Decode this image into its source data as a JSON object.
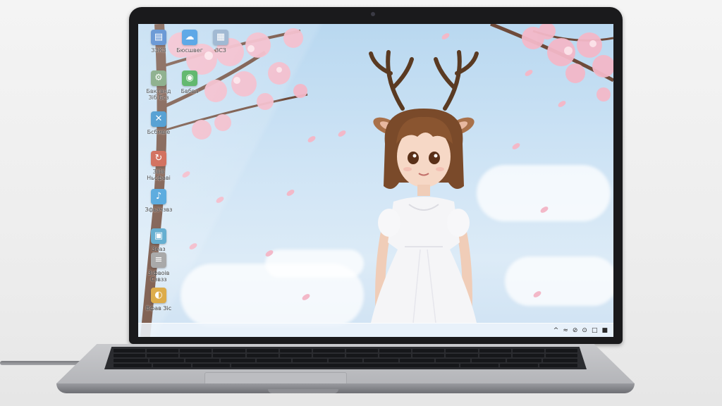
{
  "desktop": {
    "icons": [
      {
        "label": "ЗЭКЗ",
        "icon": "folder-icon",
        "color": "#3a78c8"
      },
      {
        "label": "Бюсшвег",
        "icon": "cloud-icon",
        "color": "#2f8fe0"
      },
      {
        "label": "ЗСЗ",
        "icon": "window-icon",
        "color": "#8aa8c8"
      },
      {
        "label": "Бвктвнд Зіб Бсз",
        "icon": "settings-icon",
        "color": "#6e9a6e"
      },
      {
        "label": "Бвбва",
        "icon": "chrome-icon",
        "color": "#3aa64a"
      },
      {
        "label": "Бсбмвіе",
        "icon": "tools-icon",
        "color": "#2a88c8"
      },
      {
        "label": "Звів Ньсфаві",
        "icon": "sync-icon",
        "color": "#c8503a"
      },
      {
        "label": "Зфьзчзвз",
        "icon": "music-icon",
        "color": "#3a9ad8"
      },
      {
        "label": "Зеаз",
        "icon": "gallery-icon",
        "color": "#4aa0c8"
      },
      {
        "label": "Зіфвоів Сзвзз",
        "icon": "document-icon",
        "color": "#9a9a9a"
      },
      {
        "label": "Вфав Зіс",
        "icon": "browser-icon",
        "color": "#d8a030"
      }
    ]
  },
  "taskbar": {
    "tray": [
      "^",
      "≈",
      "⊘",
      "⊙",
      "□",
      "■"
    ]
  },
  "colors": {
    "sky": "#cfe4f5",
    "blossom": "#f3b8c8",
    "lid": "#1a1a1c"
  }
}
